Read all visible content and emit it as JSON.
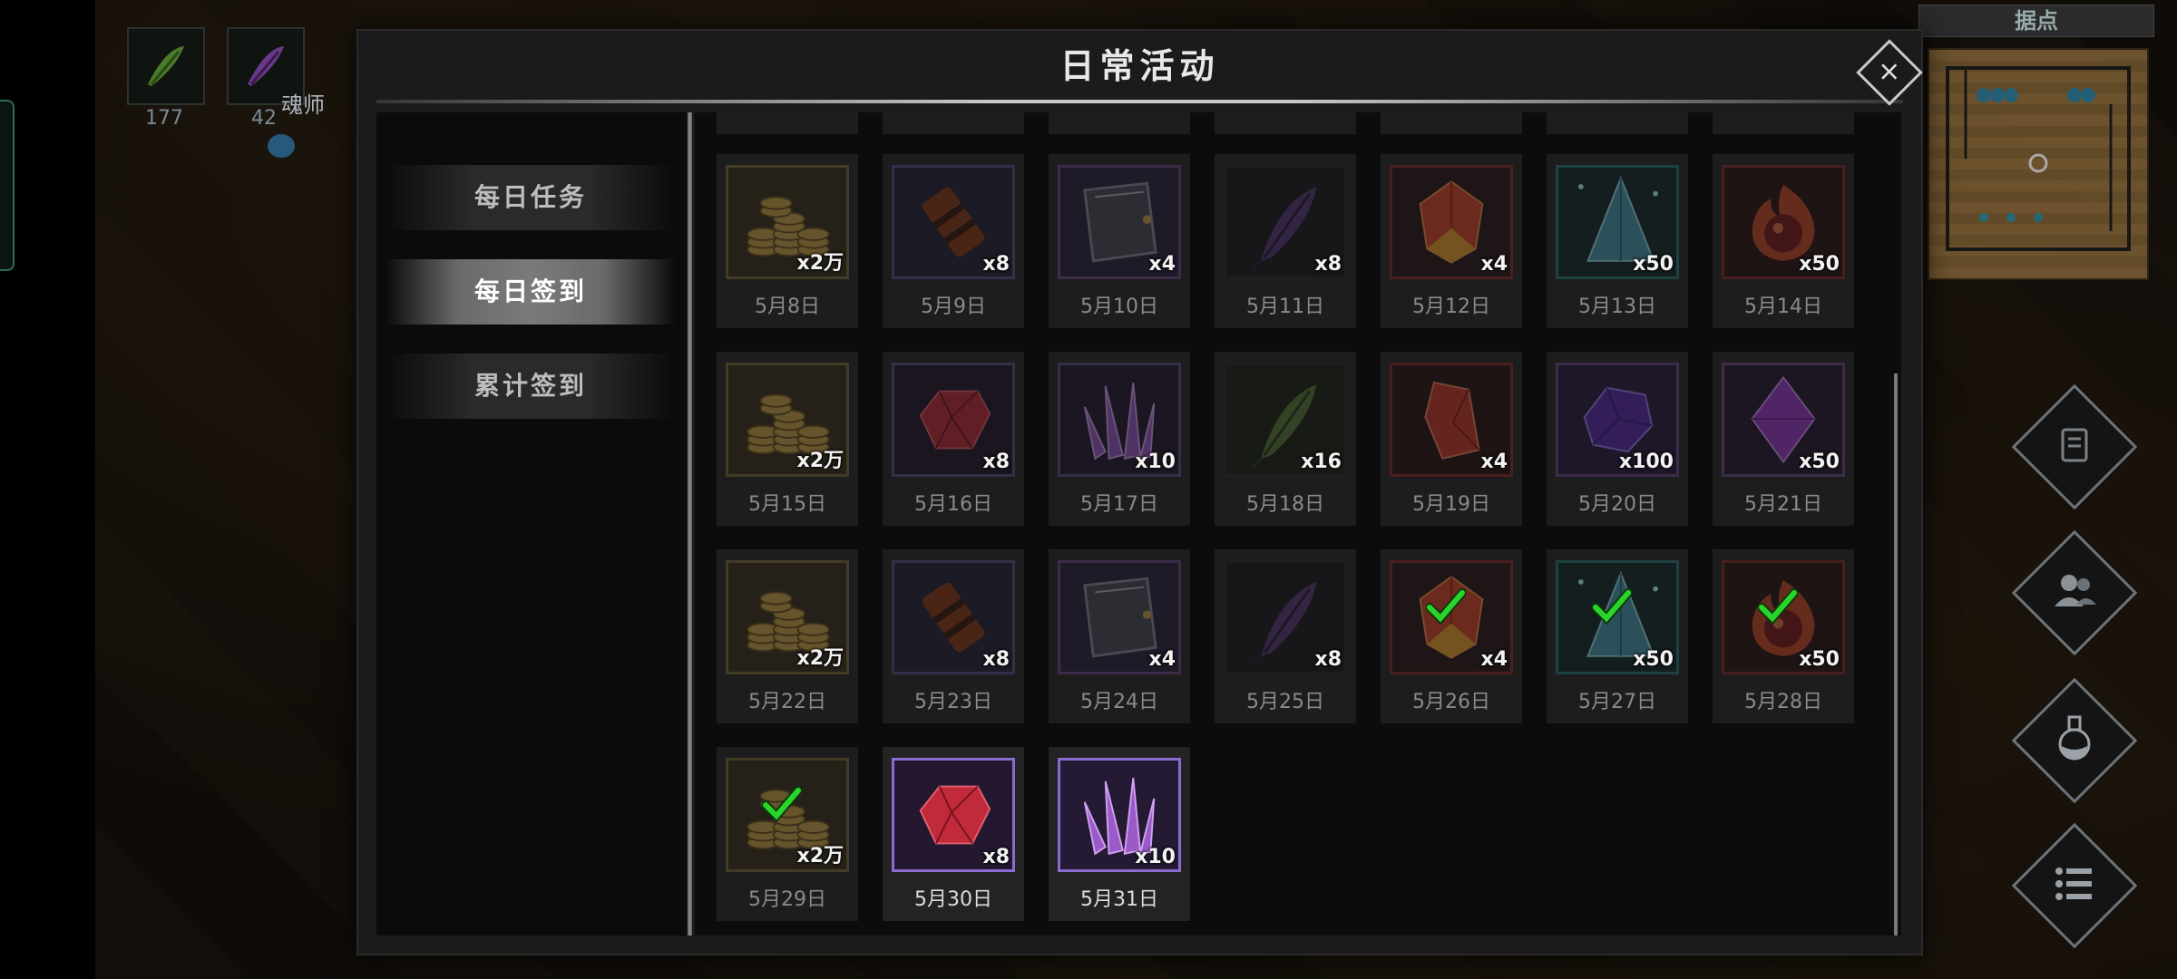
{
  "dialog": {
    "title": "日常活动",
    "close_label": "×"
  },
  "nav": [
    {
      "label": "每日任务",
      "active": false
    },
    {
      "label": "每日签到",
      "active": true
    },
    {
      "label": "累计签到",
      "active": false
    }
  ],
  "hud": {
    "slots": [
      {
        "icon": "green-feather-icon",
        "count": "177"
      },
      {
        "icon": "purple-feather-icon",
        "count": "42"
      }
    ],
    "player_name": "魂师"
  },
  "minimap": {
    "title": "据点"
  },
  "side_buttons": [
    {
      "icon": "quest-scroll-icon"
    },
    {
      "icon": "friends-icon"
    },
    {
      "icon": "potion-icon"
    },
    {
      "icon": "menu-list-icon"
    }
  ],
  "rewards": [
    {
      "date": "5月8日",
      "item": "gold-coins",
      "qty": "x2万",
      "frame": "#7a6a3a",
      "claimed": false,
      "dim": true
    },
    {
      "date": "5月9日",
      "item": "wrapped-scroll",
      "qty": "x8",
      "frame": "#5e4e8a",
      "claimed": false,
      "dim": true
    },
    {
      "date": "5月10日",
      "item": "skill-book",
      "qty": "x4",
      "frame": "#6e4a8a",
      "claimed": false,
      "dim": true
    },
    {
      "date": "5月11日",
      "item": "purple-feather",
      "qty": "x8",
      "frame": "#2b2b2b",
      "claimed": false,
      "dim": true
    },
    {
      "date": "5月12日",
      "item": "fire-gem",
      "qty": "x4",
      "frame": "#8a2a2a",
      "claimed": false,
      "dim": true
    },
    {
      "date": "5月13日",
      "item": "crystal-pyramid",
      "qty": "x50",
      "frame": "#2a7a7a",
      "claimed": false,
      "dim": true
    },
    {
      "date": "5月14日",
      "item": "flame-orb",
      "qty": "x50",
      "frame": "#8a2a2a",
      "claimed": false,
      "dim": true
    },
    {
      "date": "5月15日",
      "item": "gold-coins",
      "qty": "x2万",
      "frame": "#7a6a3a",
      "claimed": false,
      "dim": true
    },
    {
      "date": "5月16日",
      "item": "red-ruby",
      "qty": "x8",
      "frame": "#5e4e8a",
      "claimed": false,
      "dim": true
    },
    {
      "date": "5月17日",
      "item": "crystal-cluster",
      "qty": "x10",
      "frame": "#5e4e8a",
      "claimed": false,
      "dim": true
    },
    {
      "date": "5月18日",
      "item": "green-feather",
      "qty": "x16",
      "frame": "#2b2b2b",
      "claimed": false,
      "dim": true
    },
    {
      "date": "5月19日",
      "item": "red-crystal",
      "qty": "x4",
      "frame": "#8a2a2a",
      "claimed": false,
      "dim": true
    },
    {
      "date": "5月20日",
      "item": "purple-gem",
      "qty": "x100",
      "frame": "#6e4a8a",
      "claimed": false,
      "dim": true
    },
    {
      "date": "5月21日",
      "item": "purple-octahedron",
      "qty": "x50",
      "frame": "#6e4a8a",
      "claimed": false,
      "dim": true
    },
    {
      "date": "5月22日",
      "item": "gold-coins",
      "qty": "x2万",
      "frame": "#7a6a3a",
      "claimed": false,
      "dim": true
    },
    {
      "date": "5月23日",
      "item": "wrapped-scroll",
      "qty": "x8",
      "frame": "#5e4e8a",
      "claimed": false,
      "dim": true
    },
    {
      "date": "5月24日",
      "item": "skill-book",
      "qty": "x4",
      "frame": "#6e4a8a",
      "claimed": false,
      "dim": true
    },
    {
      "date": "5月25日",
      "item": "purple-feather",
      "qty": "x8",
      "frame": "#2b2b2b",
      "claimed": false,
      "dim": true
    },
    {
      "date": "5月26日",
      "item": "fire-gem",
      "qty": "x4",
      "frame": "#8a2a2a",
      "claimed": true,
      "dim": true
    },
    {
      "date": "5月27日",
      "item": "crystal-pyramid",
      "qty": "x50",
      "frame": "#2a7a7a",
      "claimed": true,
      "dim": true
    },
    {
      "date": "5月28日",
      "item": "flame-orb",
      "qty": "x50",
      "frame": "#8a2a2a",
      "claimed": true,
      "dim": true
    },
    {
      "date": "5月29日",
      "item": "gold-coins",
      "qty": "x2万",
      "frame": "#7a6a3a",
      "claimed": true,
      "dim": true
    },
    {
      "date": "5月30日",
      "item": "red-ruby",
      "qty": "x8",
      "frame": "#8a6bd0",
      "claimed": false,
      "dim": false
    },
    {
      "date": "5月31日",
      "item": "crystal-cluster",
      "qty": "x10",
      "frame": "#8a6bd0",
      "claimed": false,
      "dim": false
    }
  ],
  "colors": {
    "check": "#2bd42b",
    "title_rule": "#c8c8c8"
  }
}
